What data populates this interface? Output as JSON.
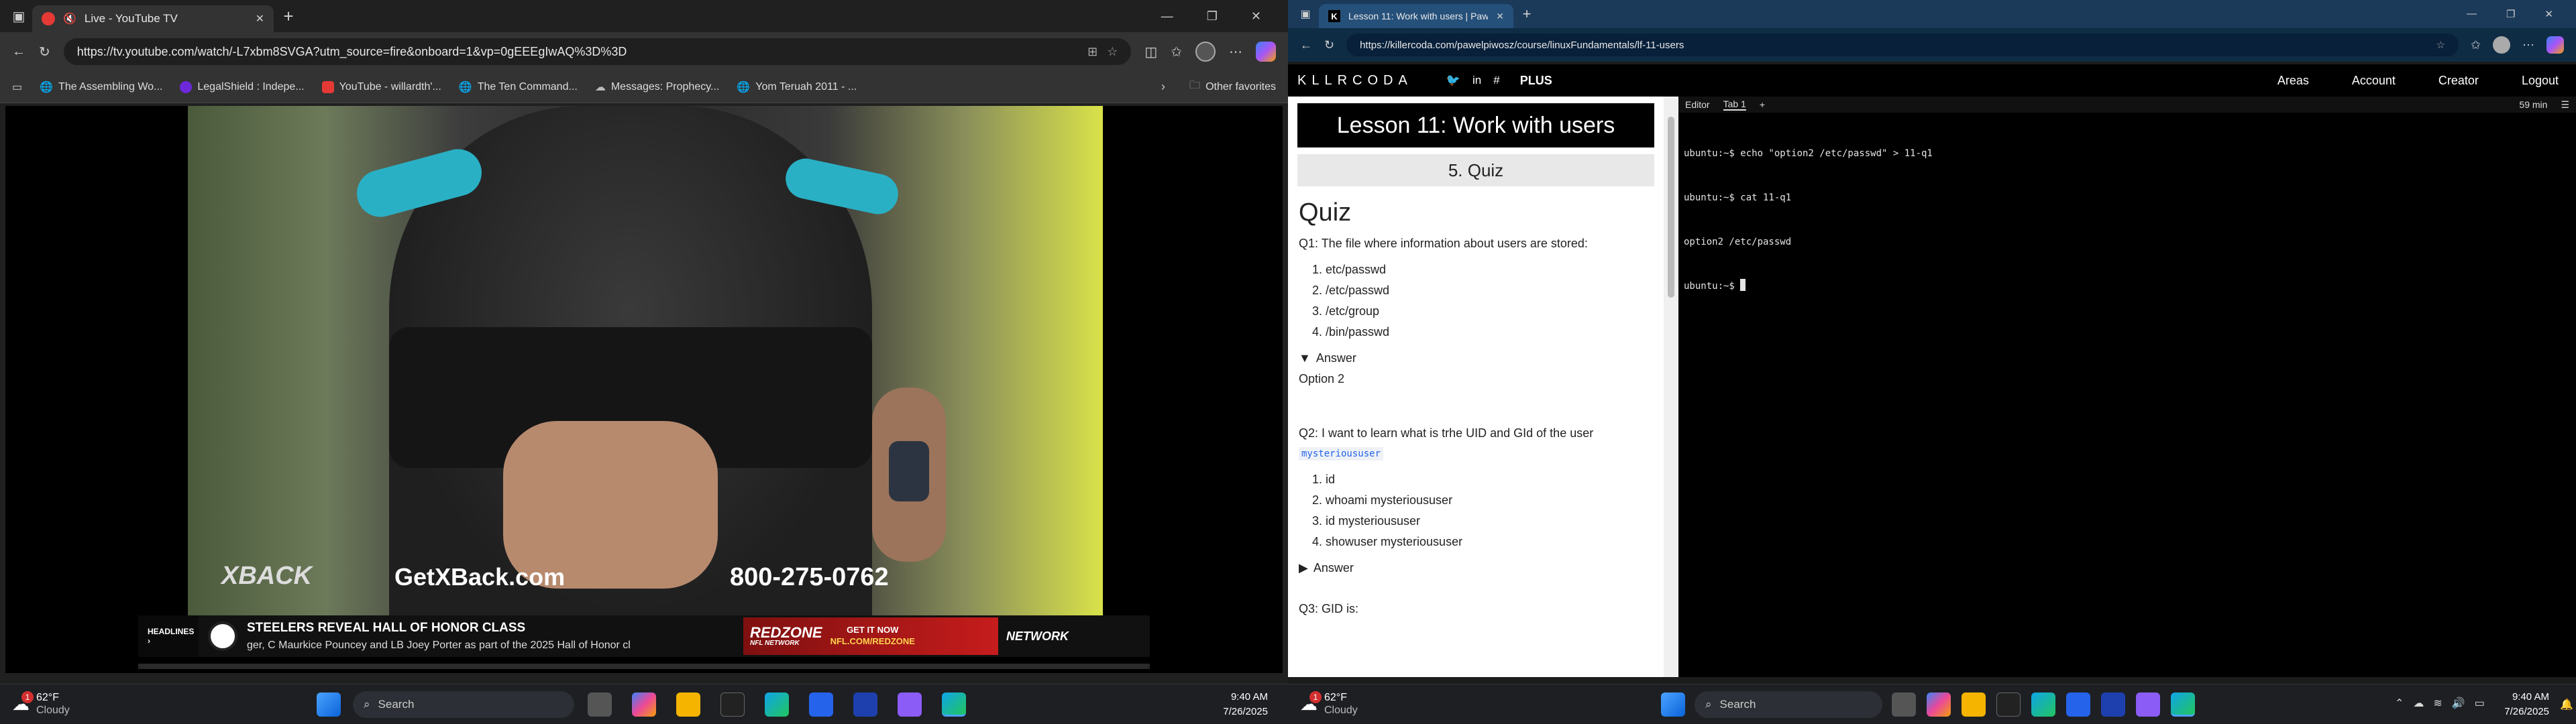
{
  "left_browser": {
    "tab_title": "Live - YouTube TV",
    "new_tab": "+",
    "url": "https://tv.youtube.com/watch/-L7xbm8SVGA?utm_source=fire&onboard=1&vp=0gEEEgIwAQ%3D%3D",
    "bookmarks": [
      {
        "label": "The Assembling Wo...",
        "icon": "globe-icon"
      },
      {
        "label": "LegalShield : Indepe...",
        "icon": "legalshield-icon"
      },
      {
        "label": "YouTube - willardth'...",
        "icon": "youtube-icon"
      },
      {
        "label": "The Ten Command...",
        "icon": "globe-icon"
      },
      {
        "label": "Messages: Prophecy...",
        "icon": "messages-icon"
      },
      {
        "label": "Yom Teruah 2011 - ...",
        "icon": "globe-icon"
      }
    ],
    "other_favorites": "Other favorites",
    "video": {
      "brand_x": "XBACK",
      "website": "GetXBack.com",
      "phone": "800-275-0762",
      "ticker_label": "HEADLINES",
      "headline": "STEELERS REVEAL HALL OF HONOR CLASS",
      "subline": "ger, C Maurkice Pouncey and LB Joey Porter as part of the 2025 Hall of Honor cl",
      "ad_title": "REDZONE",
      "ad_sub": "NFL NETWORK",
      "ad_cta1": "GET IT NOW",
      "ad_cta2": "NFL.COM/REDZONE",
      "network": "NETWORK"
    }
  },
  "right_browser": {
    "tab_title": "Lesson 11: Work with users | Pawe",
    "new_tab": "+",
    "url": "https://killercoda.com/pawelpiwosz/course/linuxFundamentals/lf-11-users",
    "topnav": {
      "logo": "KLLRCODA",
      "plus": "PLUS",
      "links": [
        "Areas",
        "Account",
        "Creator",
        "Logout"
      ]
    },
    "lesson_title": "Lesson 11: Work with users",
    "step_title": "5. Quiz",
    "quiz_heading": "Quiz",
    "q1": "Q1: The file where information about users are stored:",
    "q1_options": [
      "etc/passwd",
      "/etc/passwd",
      "/etc/group",
      "/bin/passwd"
    ],
    "answer_label_open": "Answer",
    "answer_text": "Option 2",
    "q2": "Q2: I want to learn what is trhe UID and GId of the user",
    "q2_code": "mysterioususer",
    "q2_options": [
      "id",
      "whoami mysterioususer",
      "id mysterioususer",
      "showuser mysterioususer"
    ],
    "answer_label_closed": "Answer",
    "q3": "Q3: GID is:",
    "editor_tab": "Editor",
    "tab1": "Tab 1",
    "add_tab": "+",
    "timer": "59 min",
    "terminal_lines": [
      "ubuntu:~$ echo \"option2 /etc/passwd\" > 11-q1",
      "ubuntu:~$ cat 11-q1",
      "option2 /etc/passwd",
      "ubuntu:~$ "
    ]
  },
  "taskbar_left": {
    "temp": "62°F",
    "weather": "Cloudy",
    "badge": "1",
    "search": "Search",
    "time": "9:40 AM",
    "date": "7/26/2025"
  },
  "taskbar_right": {
    "temp": "62°F",
    "weather": "Cloudy",
    "badge": "1",
    "search": "Search",
    "time": "9:40 AM",
    "date": "7/26/2025"
  }
}
